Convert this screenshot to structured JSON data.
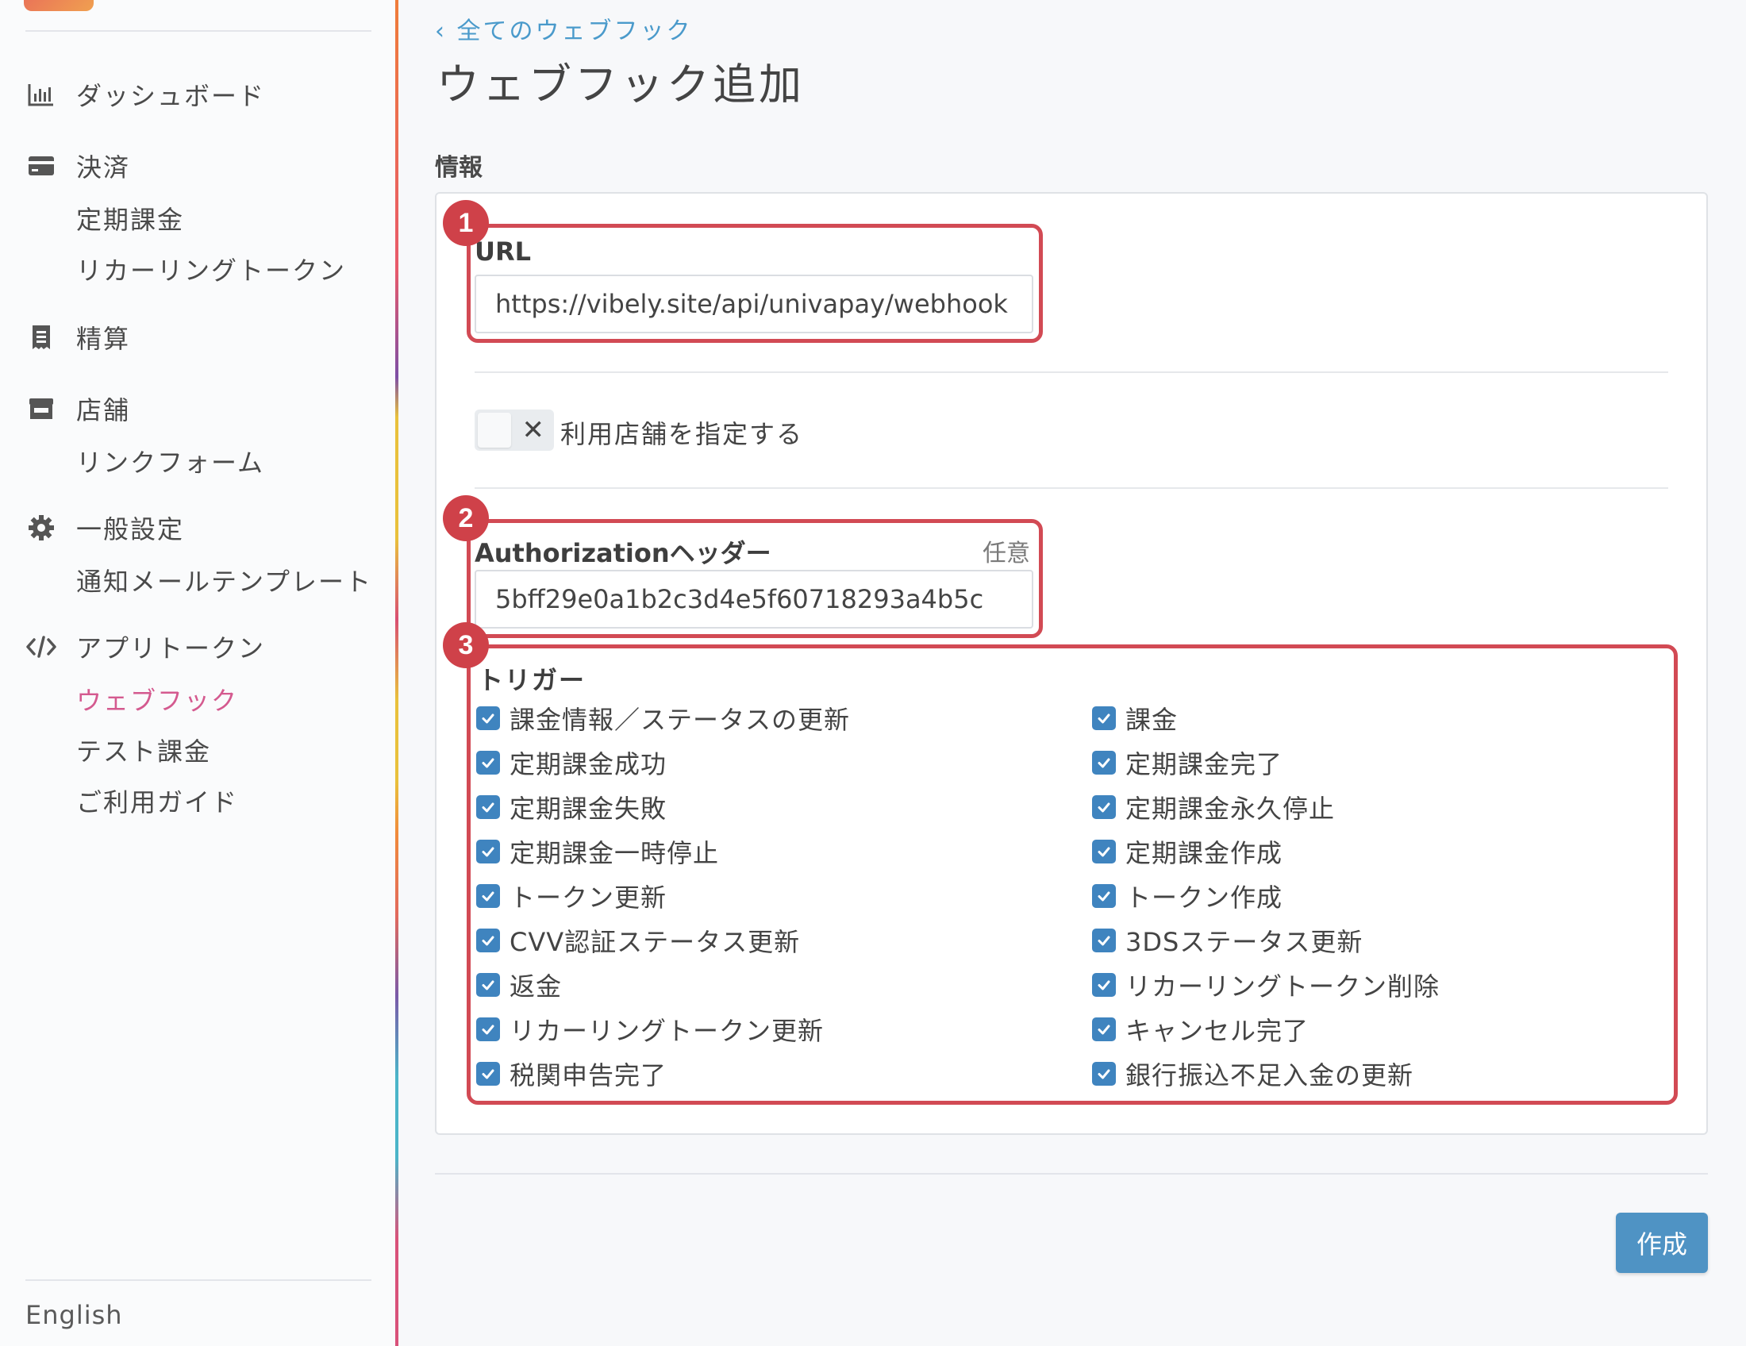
{
  "sidebar": {
    "sections": [
      {
        "icon": "bar-chart-icon",
        "label": "ダッシュボード",
        "subitems": []
      },
      {
        "icon": "credit-card-icon",
        "label": "決済",
        "subitems": [
          "定期課金",
          "リカーリングトークン"
        ]
      },
      {
        "icon": "receipt-icon",
        "label": "精算",
        "subitems": []
      },
      {
        "icon": "store-icon",
        "label": "店舗",
        "subitems": [
          "リンクフォーム"
        ]
      },
      {
        "icon": "gear-icon",
        "label": "一般設定",
        "subitems": [
          "通知メールテンプレート"
        ]
      },
      {
        "icon": "code-icon",
        "label": "アプリトークン",
        "subitems": [
          "ウェブフック",
          "テスト課金",
          "ご利用ガイド"
        ]
      }
    ],
    "active_item": "ウェブフック",
    "language": "English"
  },
  "main": {
    "back_link": "‹ 全てのウェブフック",
    "title": "ウェブフック追加",
    "section_title": "情報",
    "url_label": "URL",
    "url_value": "https://vibely.site/api/univapay/webhook",
    "toggle_label": "利用店舗を指定する",
    "toggle_on": false,
    "auth_label": "Authorizationヘッダー",
    "auth_optional": "任意",
    "auth_value": "5bff29e0a1b2c3d4e5f60718293a4b5c",
    "trigger_title": "トリガー",
    "triggers_left": [
      "課金情報／ステータスの更新",
      "定期課金成功",
      "定期課金失敗",
      "定期課金一時停止",
      "トークン更新",
      "CVV認証ステータス更新",
      "返金",
      "リカーリングトークン更新",
      "税関申告完了"
    ],
    "triggers_right": [
      "課金",
      "定期課金完了",
      "定期課金永久停止",
      "定期課金作成",
      "トークン作成",
      "3DSステータス更新",
      "リカーリングトークン削除",
      "キャンセル完了",
      "銀行振込不足入金の更新"
    ],
    "create_button": "作成"
  },
  "annotations": [
    "1",
    "2",
    "3"
  ],
  "colors": {
    "accent": "#4f93c4",
    "active_nav": "#d45a8f",
    "annotation": "#d24a54",
    "link": "#4a9acb"
  }
}
